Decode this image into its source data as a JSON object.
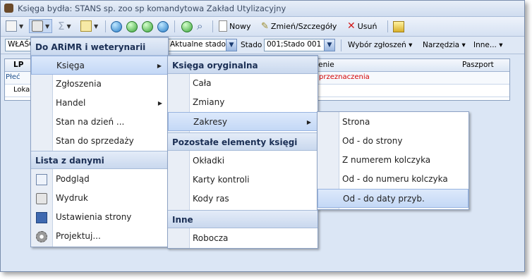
{
  "window": {
    "title": "Księga bydła: STANS sp. zoo sp komandytowa Zakład Utylizacyjny"
  },
  "toolbar": {
    "nowy_label": "Nowy",
    "zmien_label": "Zmień/Szczegóły",
    "usun_label": "Usuń"
  },
  "filterbar": {
    "owner_value": "WŁAŚC",
    "stado_combo_value": "Aktualne stado",
    "stado_label": "Stado",
    "stado_value": "001;Stado 001",
    "menu_wybor": "Wybór zgłoszeń ▾",
    "menu_narzedzia": "Narzędzia ▾",
    "menu_inne": "Inne... ▾"
  },
  "grid": {
    "col_lp": "LP",
    "col_przeznaczenie": "dzenie",
    "col_paszport": "Paszport",
    "row1_label": "Płeć",
    "row1_value": "przeznaczenia",
    "row2_label": "Lokal"
  },
  "menu1": {
    "header1": "Do ARiMR i weterynarii",
    "items": [
      "Księga",
      "Zgłoszenia",
      "Handel",
      "Stan na dzień ...",
      "Stan do sprzedaży"
    ],
    "header2": "Lista z danymi",
    "items2": [
      "Podgląd",
      "Wydruk",
      "Ustawienia strony",
      "Projektuj..."
    ]
  },
  "menu2": {
    "header1": "Księga oryginalna",
    "items1": [
      "Cała",
      "Zmiany",
      "Zakresy"
    ],
    "header2": "Pozostałe elementy księgi",
    "items2": [
      "Okładki",
      "Karty kontroli",
      "Kody ras"
    ],
    "header3": "Inne",
    "items3": [
      "Robocza"
    ]
  },
  "menu3": {
    "items": [
      "Strona",
      "Od - do strony",
      "Z numerem kolczyka",
      "Od - do numeru kolczyka",
      "Od - do daty przyb."
    ]
  },
  "colors": {
    "accent": "#1b2f55",
    "selection": "#c4d8f6",
    "warning_text": "#d40000"
  }
}
